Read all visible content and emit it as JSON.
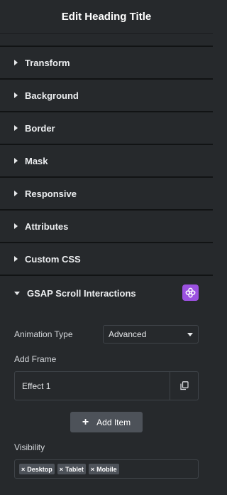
{
  "header": {
    "title": "Edit Heading Title"
  },
  "sections": [
    {
      "label": "Transform"
    },
    {
      "label": "Background"
    },
    {
      "label": "Border"
    },
    {
      "label": "Mask"
    },
    {
      "label": "Responsive"
    },
    {
      "label": "Attributes"
    },
    {
      "label": "Custom CSS"
    },
    {
      "label": "GSAP Scroll Interactions"
    }
  ],
  "gsap": {
    "icon": "gsap-plugin-icon",
    "accent_color": "#9b51e0",
    "animation_type_label": "Animation Type",
    "animation_type_value": "Advanced",
    "add_frame_label": "Add Frame",
    "frames": [
      {
        "name": "Effect 1"
      }
    ],
    "add_item_label": "Add Item",
    "visibility_label": "Visibility",
    "visibility_chips": [
      "Desktop",
      "Tablet",
      "Mobile"
    ]
  }
}
